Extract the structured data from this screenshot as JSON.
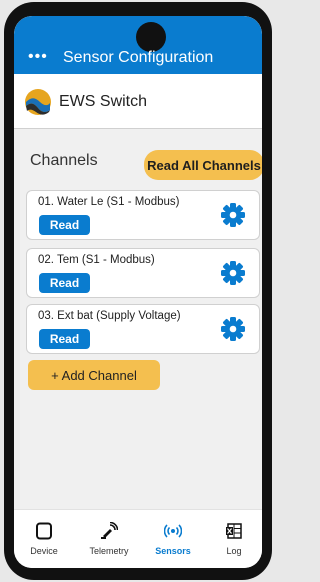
{
  "app_bar": {
    "menu_icon": "more-horizontal-icon",
    "title": "Sensor Configuration"
  },
  "brand": {
    "logo_icon": "ews-logo-icon",
    "name": "EWS Switch"
  },
  "channels": {
    "title": "Channels",
    "read_all_label": "Read All Channels",
    "items": [
      {
        "label": "01. Water Le (S1 - Modbus)",
        "read_label": "Read",
        "settings_icon": "gear-icon"
      },
      {
        "label": "02. Tem (S1 - Modbus)",
        "read_label": "Read",
        "settings_icon": "gear-icon"
      },
      {
        "label": "03. Ext bat (Supply Voltage)",
        "read_label": "Read",
        "settings_icon": "gear-icon"
      }
    ],
    "add_label": "+ Add Channel"
  },
  "bottom_nav": {
    "items": [
      {
        "label": "Device",
        "icon": "device-icon",
        "active": false
      },
      {
        "label": "Telemetry",
        "icon": "satellite-icon",
        "active": false
      },
      {
        "label": "Sensors",
        "icon": "sensors-icon",
        "active": true
      },
      {
        "label": "Log",
        "icon": "log-icon",
        "active": false
      }
    ]
  },
  "colors": {
    "primary": "#0a7ccf",
    "accent": "#f4bf4f",
    "surface": "#f0f0f0"
  }
}
